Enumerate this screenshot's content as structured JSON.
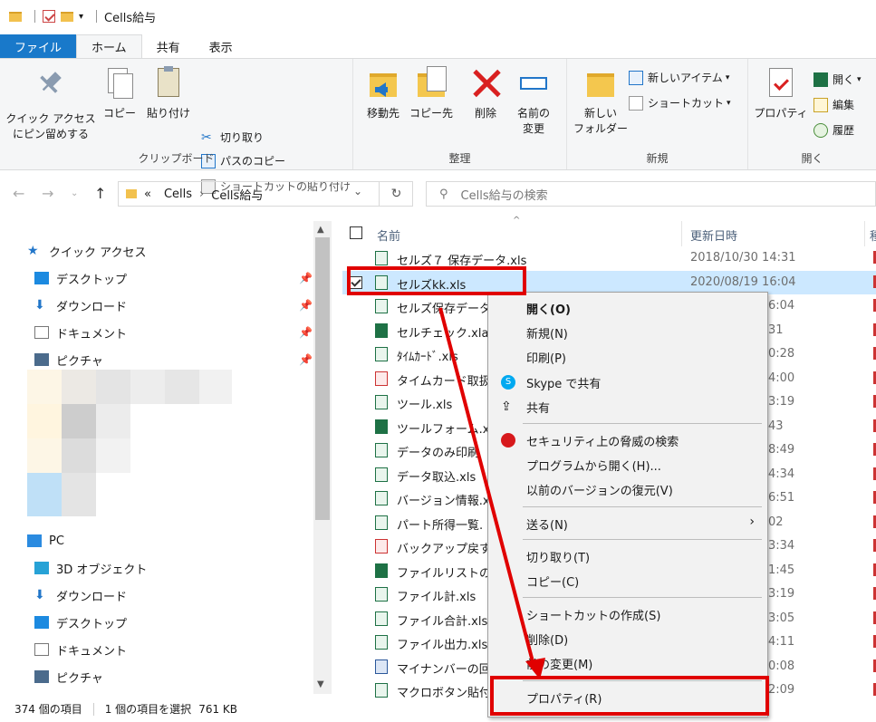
{
  "window": {
    "title": "Cells給与"
  },
  "ribbon_tabs": [
    "ファイル",
    "ホーム",
    "共有",
    "表示"
  ],
  "ribbon": {
    "clipboard": {
      "pin_line1": "クイック アクセス",
      "pin_line2": "にピン留めする",
      "copy": "コピー",
      "paste": "貼り付け",
      "cut": "切り取り",
      "copy_path": "パスのコピー",
      "paste_shortcut": "ショートカットの貼り付け",
      "label": "クリップボード"
    },
    "organize": {
      "move_to": "移動先",
      "copy_to": "コピー先",
      "delete": "削除",
      "rename_line1": "名前の",
      "rename_line2": "変更",
      "label": "整理"
    },
    "new": {
      "new_item": "新しいアイテム",
      "shortcut": "ショートカット",
      "new_folder_line1": "新しい",
      "new_folder_line2": "フォルダー",
      "label": "新規"
    },
    "open": {
      "properties": "プロパティ",
      "open": "開く",
      "edit": "編集",
      "history": "履歴",
      "label": "開く"
    }
  },
  "address": {
    "chevron": "«",
    "crumb1": "Cells",
    "crumb2": "Cells給与",
    "sep": "›",
    "search_placeholder": "Cells給与の検索"
  },
  "nav": {
    "quick_access": "クイック アクセス",
    "qa_items": [
      "デスクトップ",
      "ダウンロード",
      "ドキュメント",
      "ピクチャ"
    ],
    "pc": "PC",
    "pc_items": [
      "3D オブジェクト",
      "ダウンロード",
      "デスクトップ",
      "ドキュメント",
      "ピクチャ"
    ]
  },
  "list": {
    "col_name": "名前",
    "col_date": "更新日時",
    "col_partial": "種",
    "files": [
      {
        "name": "セルズ７ 保存データ.xls",
        "date": "2018/10/30 14:31",
        "date_tail": "",
        "icon": "xls"
      },
      {
        "name": "セルズkk.xls",
        "date": "2020/08/19 16:04",
        "date_tail": "",
        "icon": "xls"
      },
      {
        "name": "セルズ保存データ",
        "date": "",
        "date_tail": "6:04",
        "icon": "xls"
      },
      {
        "name": "セルチェック.xla",
        "date": "",
        "date_tail": "31",
        "icon": "xlsx"
      },
      {
        "name": "ﾀｲﾑｶｰﾄﾞ.xls",
        "date": "",
        "date_tail": "0:28",
        "icon": "xls"
      },
      {
        "name": "タイムカード取扱",
        "date": "",
        "date_tail": "4:00",
        "icon": "pdf"
      },
      {
        "name": "ツール.xls",
        "date": "",
        "date_tail": "3:19",
        "icon": "xls"
      },
      {
        "name": "ツールフォーム.xla",
        "date": "",
        "date_tail": "43",
        "icon": "xlsx"
      },
      {
        "name": "データのみ印刷",
        "date": "",
        "date_tail": "8:49",
        "icon": "xls"
      },
      {
        "name": "データ取込.xls",
        "date": "",
        "date_tail": "4:34",
        "icon": "xls"
      },
      {
        "name": "バージョン情報.x",
        "date": "",
        "date_tail": "6:51",
        "icon": "xls"
      },
      {
        "name": "パート所得一覧.",
        "date": "",
        "date_tail": "02",
        "icon": "xls"
      },
      {
        "name": "バックアップ戻す.",
        "date": "",
        "date_tail": "3:34",
        "icon": "pdf"
      },
      {
        "name": "ファイルリストの作",
        "date": "",
        "date_tail": "1:45",
        "icon": "xlsx"
      },
      {
        "name": "ファイル計.xls",
        "date": "",
        "date_tail": "3:19",
        "icon": "xls"
      },
      {
        "name": "ファイル合計.xls",
        "date": "",
        "date_tail": "3:05",
        "icon": "xls"
      },
      {
        "name": "ファイル出力.xls",
        "date": "",
        "date_tail": "4:11",
        "icon": "xls"
      },
      {
        "name": "マイナンバーの回",
        "date": "",
        "date_tail": "0:08",
        "icon": "macro"
      },
      {
        "name": "マクロボタン貼付",
        "date": "",
        "date_tail": "2:09",
        "icon": "xls"
      }
    ]
  },
  "context_menu": {
    "open": "開く(O)",
    "new": "新規(N)",
    "print": "印刷(P)",
    "skype": "Skype で共有",
    "share": "共有",
    "security": "セキュリティ上の脅威の検索",
    "open_with": "プログラムから開く(H)...",
    "restore": "以前のバージョンの復元(V)",
    "send_to": "送る(N)",
    "cut": "切り取り(T)",
    "copy": "コピー(C)",
    "create_shortcut": "ショートカットの作成(S)",
    "delete": "削除(D)",
    "rename": "前の変更(M)",
    "properties": "プロパティ(R)"
  },
  "status": {
    "count": "374 個の項目",
    "selected": "1 個の項目を選択",
    "size": "761 KB"
  },
  "colors": {
    "file_tab": "#1979ca",
    "selection": "#cce8ff",
    "highlight": "#e00000"
  }
}
